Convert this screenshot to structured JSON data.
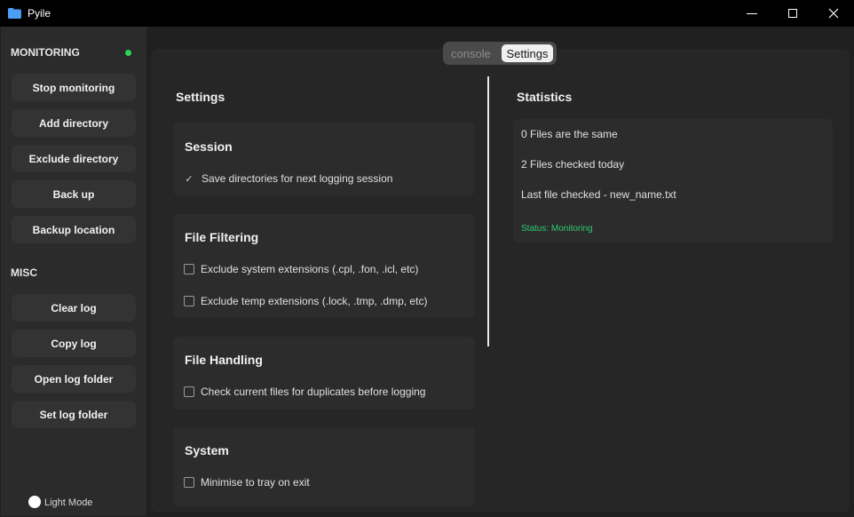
{
  "window": {
    "title": "Pyile"
  },
  "sidebar": {
    "monitoring_label": "MONITORING",
    "monitoring_buttons": [
      "Stop monitoring",
      "Add directory",
      "Exclude directory",
      "Back up",
      "Backup location"
    ],
    "misc_label": "MISC",
    "misc_buttons": [
      "Clear log",
      "Copy log",
      "Open log folder",
      "Set log folder"
    ],
    "theme_toggle_label": "Light Mode",
    "status_dot_color": "#2ed15a"
  },
  "tabs": {
    "console": "console",
    "settings": "Settings",
    "active": "Settings"
  },
  "settings": {
    "heading": "Settings",
    "session": {
      "title": "Session",
      "option": "Save directories for next logging session",
      "checked": true
    },
    "file_filtering": {
      "title": "File Filtering",
      "options": [
        "Exclude system extensions (.cpl, .fon, .icl, etc)",
        "Exclude temp extensions (.lock, .tmp, .dmp, etc)"
      ]
    },
    "file_handling": {
      "title": "File Handling",
      "option": "Check current files for duplicates before logging"
    },
    "system": {
      "title": "System",
      "option": "Minimise to tray on exit"
    }
  },
  "statistics": {
    "heading": "Statistics",
    "same_files": "0 Files are the same",
    "checked_today": "2 Files checked today",
    "last_file": "Last file checked - new_name.txt",
    "status": "Status: Monitoring",
    "status_color": "#2ecc71"
  }
}
